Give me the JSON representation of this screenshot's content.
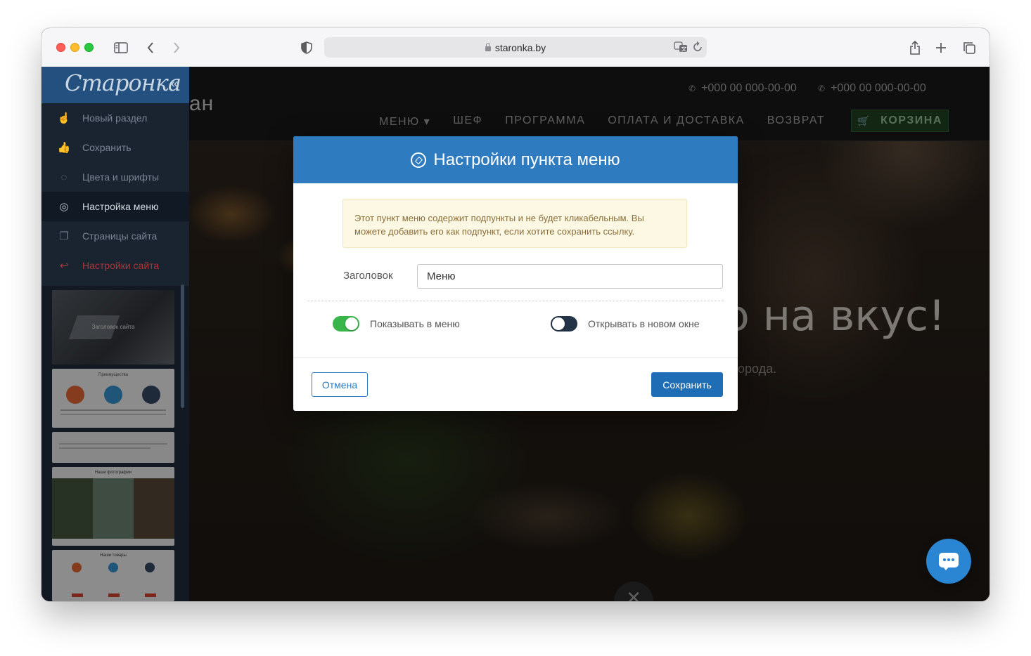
{
  "browser": {
    "url": "staronka.by"
  },
  "site": {
    "brand_partial": "ан",
    "phones": [
      "+000 00 000-00-00",
      "+000 00 000-00-00"
    ],
    "nav": [
      "МЕНЮ ▾",
      "ШЕФ",
      "ПРОГРАММА",
      "ОПЛАТА И ДОСТАВКА",
      "ВОЗВРАТ"
    ],
    "cart_label": "КОРЗИНА",
    "hero_title_partial": "о на вкус!",
    "hero_sub_partial": "орода."
  },
  "sidebar": {
    "logo": "Старонка",
    "collapse": "«",
    "items": [
      {
        "label": "Новый раздел",
        "icon": "pointer-hand-icon"
      },
      {
        "label": "Сохранить",
        "icon": "thumbs-up-icon"
      },
      {
        "label": "Цвета и шрифты",
        "icon": "lightbulb-icon"
      },
      {
        "label": "Настройка меню",
        "icon": "compass-icon"
      },
      {
        "label": "Страницы сайта",
        "icon": "pages-icon"
      },
      {
        "label": "Настройки сайта",
        "icon": "exit-icon"
      }
    ],
    "thumbnails": [
      {
        "caption": "Заголовок сайта"
      },
      {
        "caption": "Преимущества"
      },
      {
        "caption": ""
      },
      {
        "caption": "Наши фотографии"
      },
      {
        "caption": "Наши товары"
      }
    ]
  },
  "modal": {
    "title": "Настройки пункта меню",
    "alert": "Этот пункт меню содержит подпункты и не будет кликабельным. Вы можете добавить его как подпункт, если хотите сохранить ссылку.",
    "field_label": "Заголовок",
    "field_value": "Меню",
    "toggle_show_label": "Показывать в меню",
    "toggle_show_on": true,
    "toggle_newwin_label": "Открывать в новом окне",
    "toggle_newwin_on": false,
    "cancel_label": "Отмена",
    "save_label": "Сохранить"
  },
  "colors": {
    "accent": "#2e7bbf",
    "toggle_on": "#3ab54a",
    "sidebar_bg": "#1a2330",
    "danger": "#a8363b"
  }
}
